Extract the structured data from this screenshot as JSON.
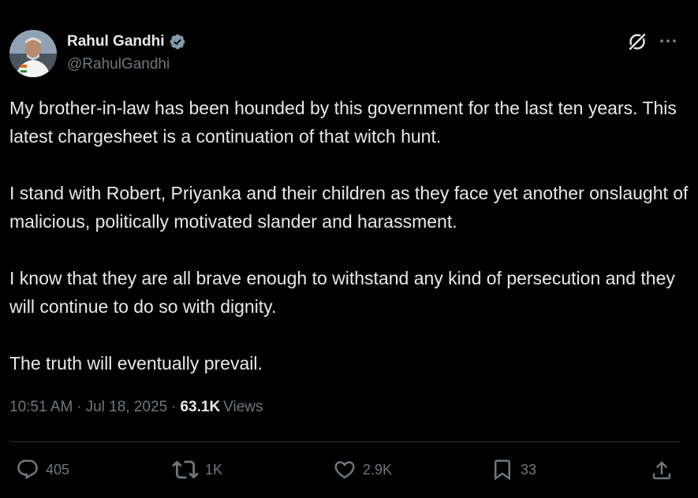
{
  "author": {
    "display_name": "Rahul Gandhi",
    "handle": "@RahulGandhi",
    "verified": true
  },
  "tweet": {
    "paragraphs": [
      "My brother-in-law has been hounded by this government for the last ten years. This latest chargesheet is a continuation of that witch hunt.",
      "I stand with Robert, Priyanka and their children as they face yet another onslaught of malicious, politically motivated slander and harassment.",
      "I know that they are all brave enough to withstand any kind of persecution and they will continue to do so with dignity.",
      "The truth will eventually prevail."
    ]
  },
  "meta": {
    "time": "10:51 AM",
    "separator": "·",
    "date": "Jul 18, 2025",
    "views_count": "63.1K",
    "views_label": "Views"
  },
  "actions": {
    "replies": "405",
    "reposts": "1K",
    "likes": "2.9K",
    "bookmarks": "33"
  },
  "icons": {
    "avatar": "avatar-photo",
    "verified": "verified-badge-icon",
    "grok": "grok-icon",
    "more": "more-options-icon",
    "reply": "reply-icon",
    "repost": "repost-icon",
    "like": "heart-icon",
    "bookmark": "bookmark-icon",
    "share": "share-icon"
  },
  "colors": {
    "background": "#000000",
    "text_primary": "#e7e9ea",
    "text_secondary": "#71767b",
    "divider": "#2f3336",
    "verified_badge": "#829aab"
  }
}
